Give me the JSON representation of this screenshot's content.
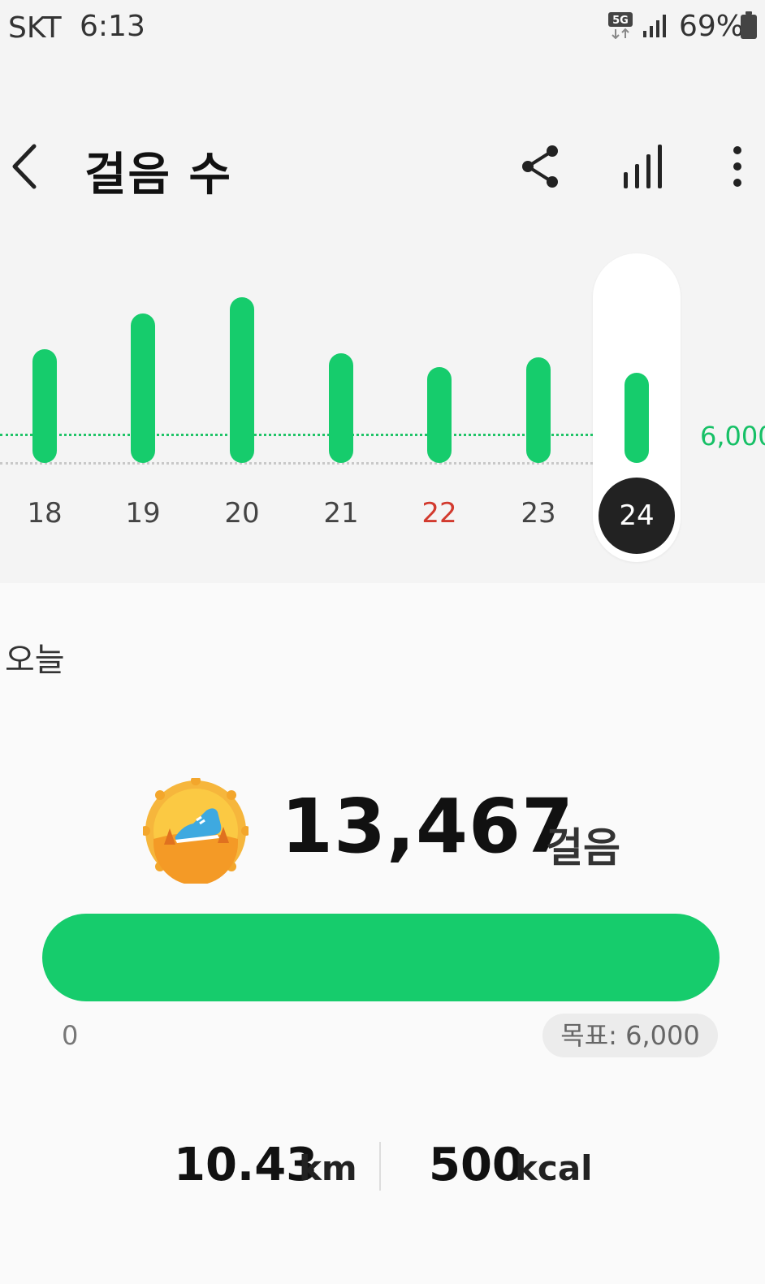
{
  "status_bar": {
    "carrier": "SKT",
    "time": "6:13",
    "network": "5G",
    "battery": "69%"
  },
  "header": {
    "title": "걸음 수",
    "icons": [
      "back-icon",
      "share-icon",
      "graph-icon",
      "more-icon"
    ]
  },
  "chart_data": {
    "type": "bar",
    "categories": [
      "18",
      "19",
      "20",
      "21",
      "22",
      "23",
      "24"
    ],
    "values": [
      10870,
      14300,
      15900,
      10470,
      9200,
      10150,
      8650
    ],
    "goal": 6000,
    "goal_label": "6,000",
    "selected": "24",
    "highlight_category": "22",
    "colors": {
      "bar": "#16cc6c",
      "goal_line": "#20c468",
      "highlight_day": "#d23a2e",
      "selected_bg": "#222222"
    }
  },
  "today": {
    "label": "오늘",
    "steps": "13,467",
    "steps_unit": "걸음",
    "progress_fraction": 1.0,
    "progress_min": "0",
    "goal_text": "목표: 6,000"
  },
  "stats": {
    "distance_value": "10.43",
    "distance_unit": "km",
    "calories_value": "500",
    "calories_unit": "kcal"
  }
}
